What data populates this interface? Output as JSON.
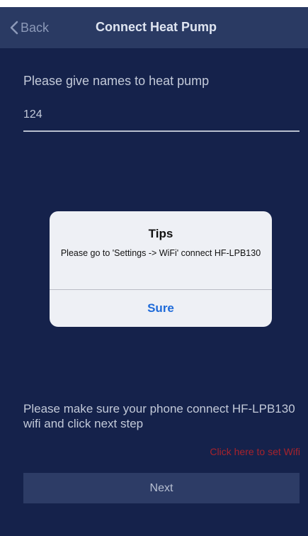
{
  "navbar": {
    "back_label": "Back",
    "title": "Connect Heat Pump"
  },
  "form": {
    "name_label": "Please give names to heat pump",
    "name_value": "124"
  },
  "dialog": {
    "title": "Tips",
    "message": "Please go to 'Settings -> WiFi' connect HF-LPB130",
    "button_label": "Sure"
  },
  "footer": {
    "instruction": "Please make sure your phone connect HF-LPB130 wifi and click next step",
    "wifi_link": "Click here to set Wifi",
    "next_label": "Next"
  },
  "colors": {
    "background": "#15224b",
    "navbar": "#2a3a63",
    "dialog_button": "#1e6ad9",
    "wifi_link": "#a7222c"
  }
}
